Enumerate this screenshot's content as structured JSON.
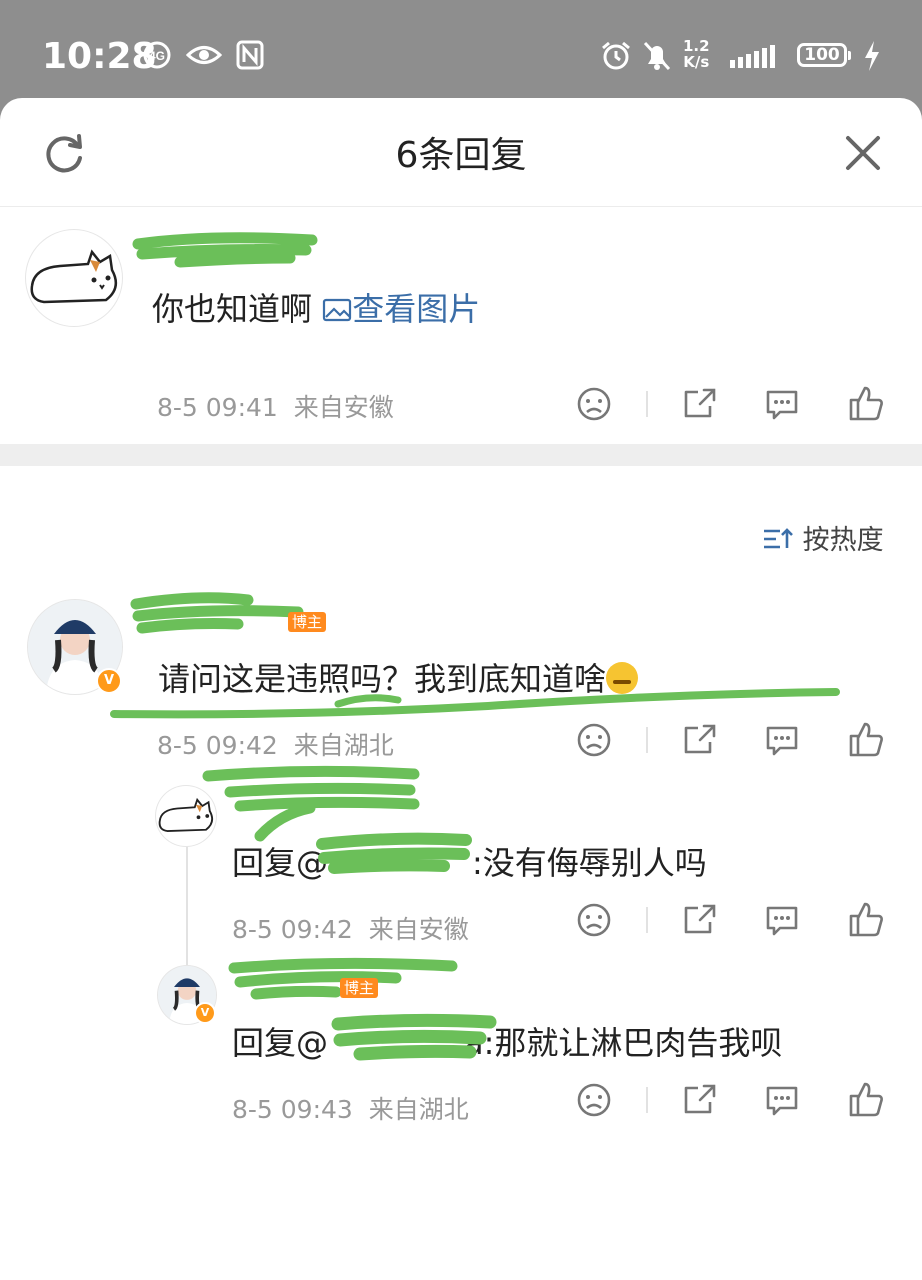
{
  "status_bar": {
    "time": "10:28",
    "net_speed_value": "1.2",
    "net_speed_unit": "K/s",
    "battery": "100"
  },
  "header": {
    "title": "6条回复"
  },
  "main_comment": {
    "text": "你也知道啊",
    "image_link": "查看图片",
    "time": "8-5 09:41",
    "location": "来自安徽"
  },
  "sort": {
    "label": "按热度"
  },
  "replies": [
    {
      "badge": "博主",
      "text": "请问这是违照吗？我到底知道啥",
      "time": "8-5 09:42",
      "location": "来自湖北"
    },
    {
      "prefix": "回复@",
      "text": ":没有侮辱别人吗",
      "time": "8-5 09:42",
      "location": "来自安徽"
    },
    {
      "badge": "博主",
      "prefix": "回复@",
      "text": "a:那就让淋巴肉告我呗",
      "time": "8-5 09:43",
      "location": "来自湖北"
    }
  ],
  "colors": {
    "link": "#3b6ea8",
    "badge": "#ff8a1e",
    "redaction": "#6bbf59"
  }
}
